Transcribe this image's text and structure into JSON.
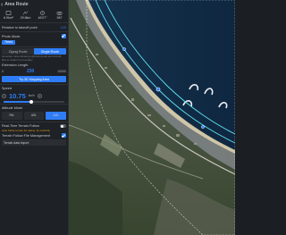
{
  "header": {
    "back_icon": "arrow-left-icon",
    "title": "Area Route"
  },
  "stats": [
    {
      "icon": "area-icon",
      "value": "6.9km²"
    },
    {
      "icon": "distance-icon",
      "value": "29.8km"
    },
    {
      "icon": "clock-icon",
      "value": "46'07\""
    },
    {
      "icon": "camera-icon",
      "value": "987"
    }
  ],
  "altitude_takeoff": {
    "label": "Relative to takeoff point",
    "value": "120"
  },
  "photo_mode": {
    "label": "Photo Mode",
    "selected": "Timed"
  },
  "route_type": {
    "options": [
      "Zigzag Route",
      "Single Route"
    ],
    "selected": "Single Route"
  },
  "description": "Generate route following optimized path and aircraft flies in relation to boundary",
  "extension": {
    "label": "Extension Length",
    "min": "0",
    "value": "230",
    "max": "10000",
    "unit": "m"
  },
  "mapping_button": "Try 3D Mapping Area",
  "speed": {
    "label": "Speed",
    "value": "10.75",
    "unit": "km/h",
    "unit2": "m/s",
    "fraction": 0.45
  },
  "attitude": {
    "label": "Altitude Mode",
    "modes": [
      "Rel.",
      "ASL",
      "AGL"
    ],
    "selected": "AGL"
  },
  "terrain": {
    "label": "Real-Time Terrain Follow",
    "on": false
  },
  "terrain_warning": "Auto follow terrain for safety; fly carefully",
  "data_follow": {
    "label": "Terrain Follow File Management"
  },
  "data_item": "Terrain data import",
  "colors": {
    "accent": "#2f7df6",
    "panel": "#1e2125",
    "warning": "#e39a1f",
    "route": "#5fe0f2"
  }
}
